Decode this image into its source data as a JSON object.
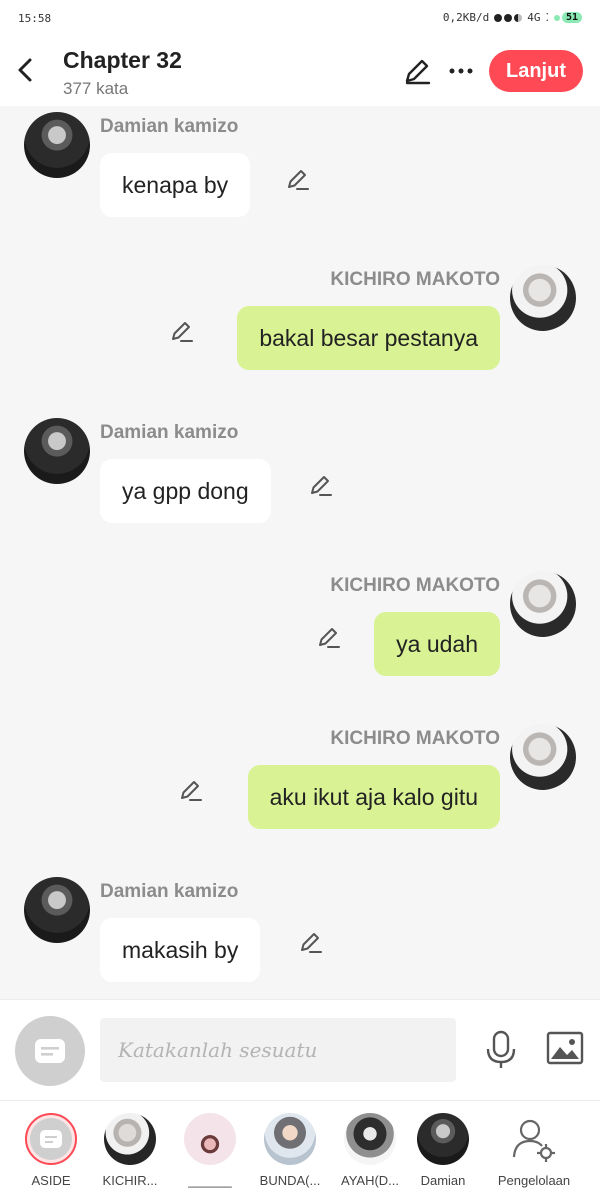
{
  "status": {
    "time": "15:58",
    "net_speed": "0,2KB/d",
    "network": "4G",
    "battery": "51"
  },
  "header": {
    "title": "Chapter 32",
    "word_count": "377 kata",
    "continue_label": "Lanjut"
  },
  "messages": [
    {
      "side": "left",
      "sender": "Damian kamizo",
      "text": "kenapa by"
    },
    {
      "side": "right",
      "sender": "KICHIRO MAKOTO",
      "text": "bakal besar pestanya"
    },
    {
      "side": "left",
      "sender": "Damian kamizo",
      "text": "ya gpp dong"
    },
    {
      "side": "right",
      "sender": "KICHIRO MAKOTO",
      "text": "ya udah"
    },
    {
      "side": "right",
      "sender": "KICHIRO MAKOTO",
      "text": "aku ikut aja kalo gitu"
    },
    {
      "side": "left",
      "sender": "Damian kamizo",
      "text": "makasih by"
    }
  ],
  "composer": {
    "placeholder": "Katakanlah sesuatu"
  },
  "characters": [
    {
      "label": "ASIDE"
    },
    {
      "label": "KICHIR..."
    },
    {
      "label": "______"
    },
    {
      "label": "BUNDA(..."
    },
    {
      "label": "AYAH(D..."
    },
    {
      "label": "Damian"
    },
    {
      "label": "Pengelolaan"
    }
  ],
  "colors": {
    "accent": "#ff4a55",
    "bubble_right": "#d8f294",
    "bubble_left": "#ffffff",
    "background": "#f6f6f6"
  }
}
